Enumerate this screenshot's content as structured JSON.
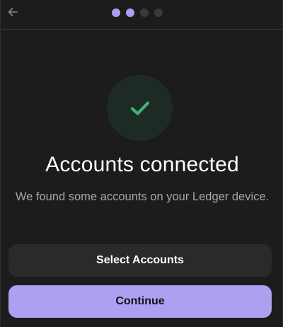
{
  "header": {
    "back_icon": "arrow-left-icon",
    "steps": [
      {
        "state": "complete"
      },
      {
        "state": "complete"
      },
      {
        "state": "pending"
      },
      {
        "state": "pending"
      }
    ],
    "progress": {
      "current_step": 2,
      "total_steps": 4
    }
  },
  "main": {
    "status_icon": "checkmark-icon",
    "title": "Accounts connected",
    "subtitle": "We found some accounts on your Ledger device."
  },
  "actions": {
    "select_accounts_label": "Select Accounts",
    "continue_label": "Continue"
  },
  "colors": {
    "accent": "#ae9ff1",
    "success": "#3fb274",
    "background": "#1c1c1c",
    "secondary_button": "#2a2a2a"
  }
}
